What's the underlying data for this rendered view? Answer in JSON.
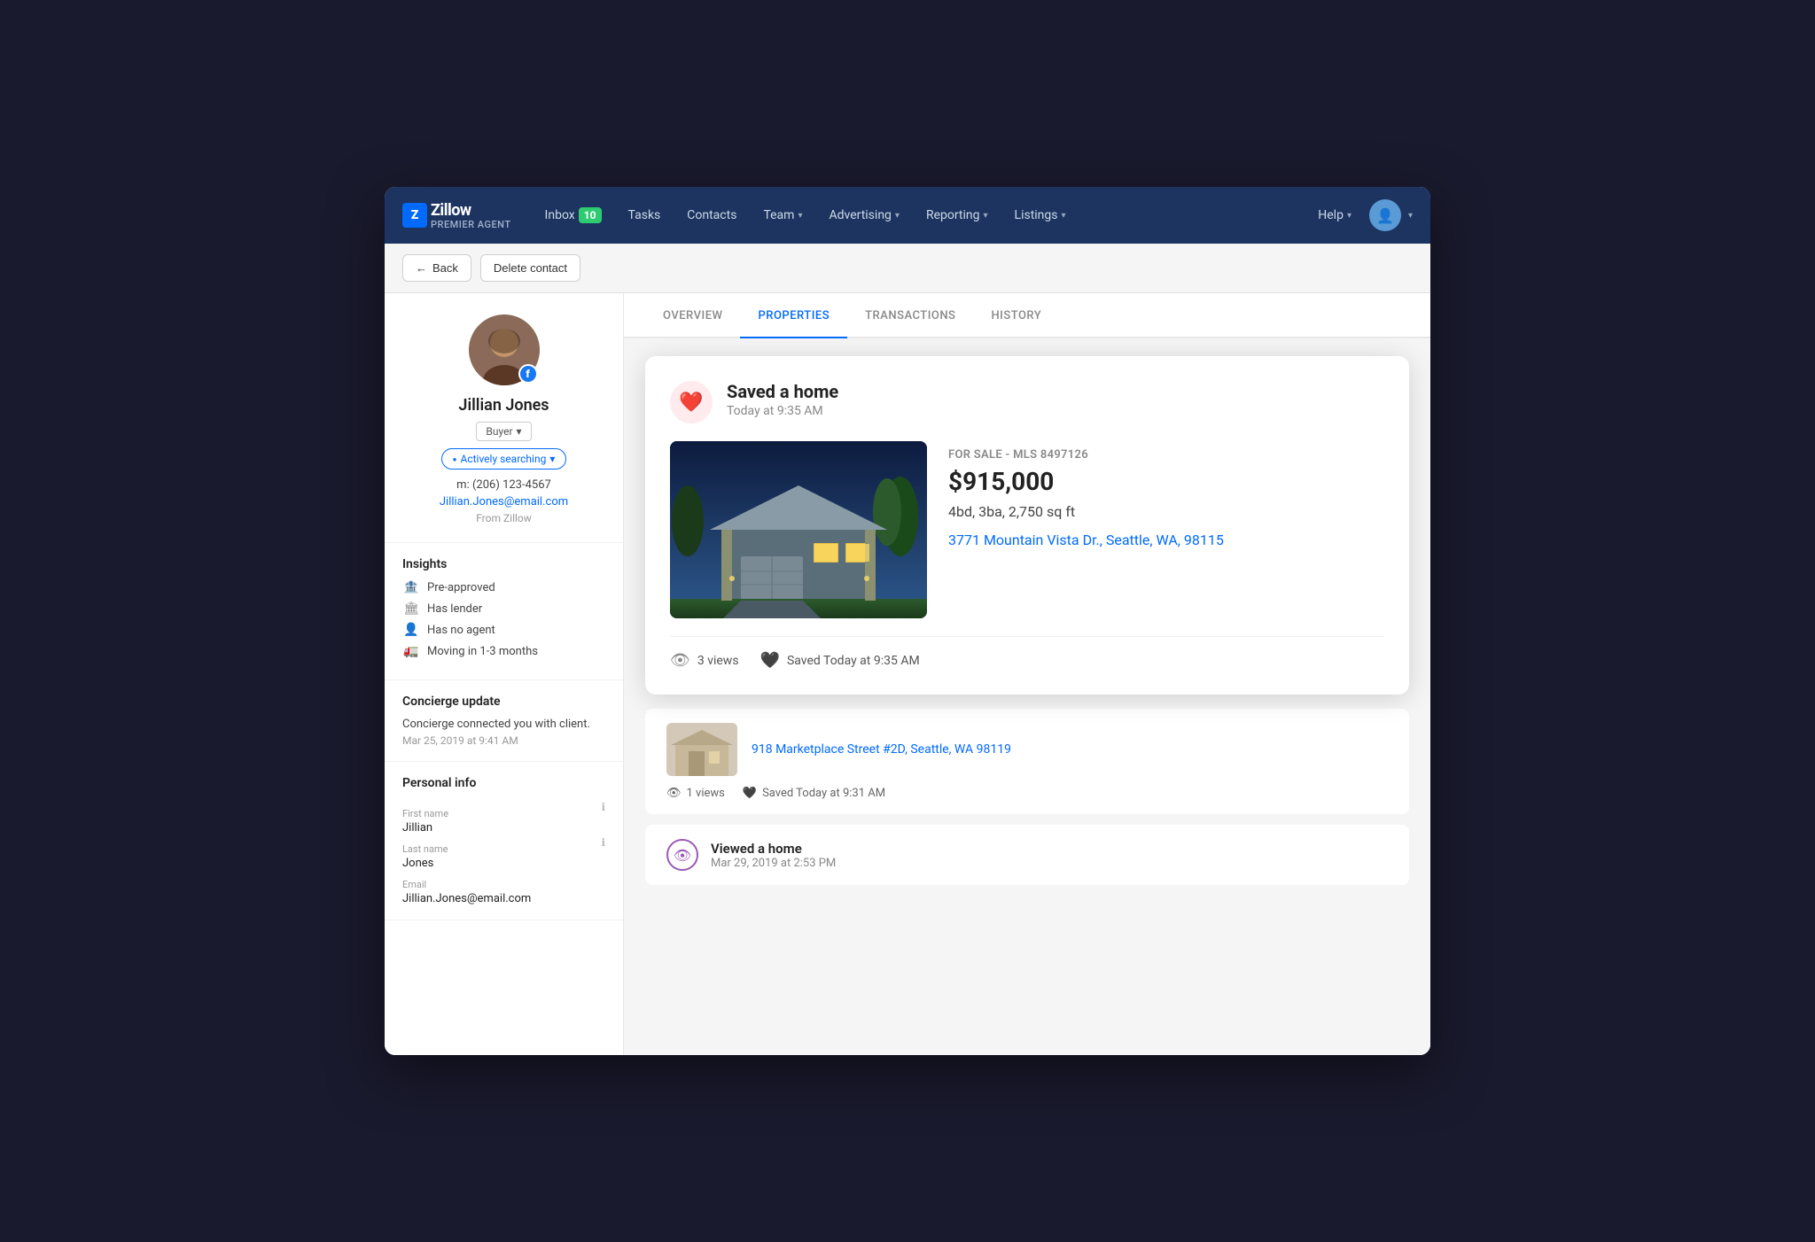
{
  "app": {
    "title": "Zillow Premier Agent"
  },
  "navbar": {
    "brand": "Zillow",
    "brand_sub": "PREMIER AGENT",
    "inbox_label": "Inbox",
    "inbox_count": "10",
    "tasks_label": "Tasks",
    "contacts_label": "Contacts",
    "team_label": "Team",
    "advertising_label": "Advertising",
    "reporting_label": "Reporting",
    "listings_label": "Listings",
    "help_label": "Help"
  },
  "toolbar": {
    "back_label": "Back",
    "delete_label": "Delete contact"
  },
  "contact": {
    "name": "Jillian Jones",
    "type": "Buyer",
    "status": "Actively searching",
    "phone": "m: (206) 123-4567",
    "email": "Jillian.Jones@email.com",
    "source": "From Zillow"
  },
  "insights": {
    "title": "Insights",
    "items": [
      {
        "icon": "✓",
        "label": "Pre-approved"
      },
      {
        "icon": "✓",
        "label": "Has lender"
      },
      {
        "icon": "✓",
        "label": "Has no agent"
      },
      {
        "icon": "✓",
        "label": "Moving in 1-3 months"
      }
    ]
  },
  "concierge": {
    "title": "Concierge update",
    "text": "Concierge connected you with client.",
    "date": "Mar 25, 2019 at 9:41 AM"
  },
  "personal_info": {
    "title": "Personal info",
    "first_name_label": "First name",
    "first_name": "Jillian",
    "last_name_label": "Last name",
    "last_name": "Jones",
    "email_label": "Email",
    "email": "Jillian.Jones@email.com"
  },
  "tabs": [
    {
      "id": "overview",
      "label": "OVERVIEW"
    },
    {
      "id": "properties",
      "label": "PROPERTIES",
      "active": true
    },
    {
      "id": "transactions",
      "label": "TRANSACTIONS"
    },
    {
      "id": "history",
      "label": "HISTORY"
    }
  ],
  "activity_card": {
    "title": "Saved a home",
    "subtitle": "Today at 9:35 AM",
    "property": {
      "status": "FOR SALE - MLS 8497126",
      "price": "$915,000",
      "details": "4bd, 3ba, 2,750 sq ft",
      "address": "3771 Mountain Vista Dr., Seattle, WA, 98115"
    },
    "views_count": "3 views",
    "saved_label": "Saved Today at 9:35 AM"
  },
  "secondary_property": {
    "address": "918 Marketplace Street #2D, Seattle, WA 98119",
    "views": "1 views",
    "saved_label": "Saved Today at 9:31 AM"
  },
  "viewed_home": {
    "title": "Viewed a home",
    "date": "Mar 29, 2019 at 2:53 PM"
  }
}
